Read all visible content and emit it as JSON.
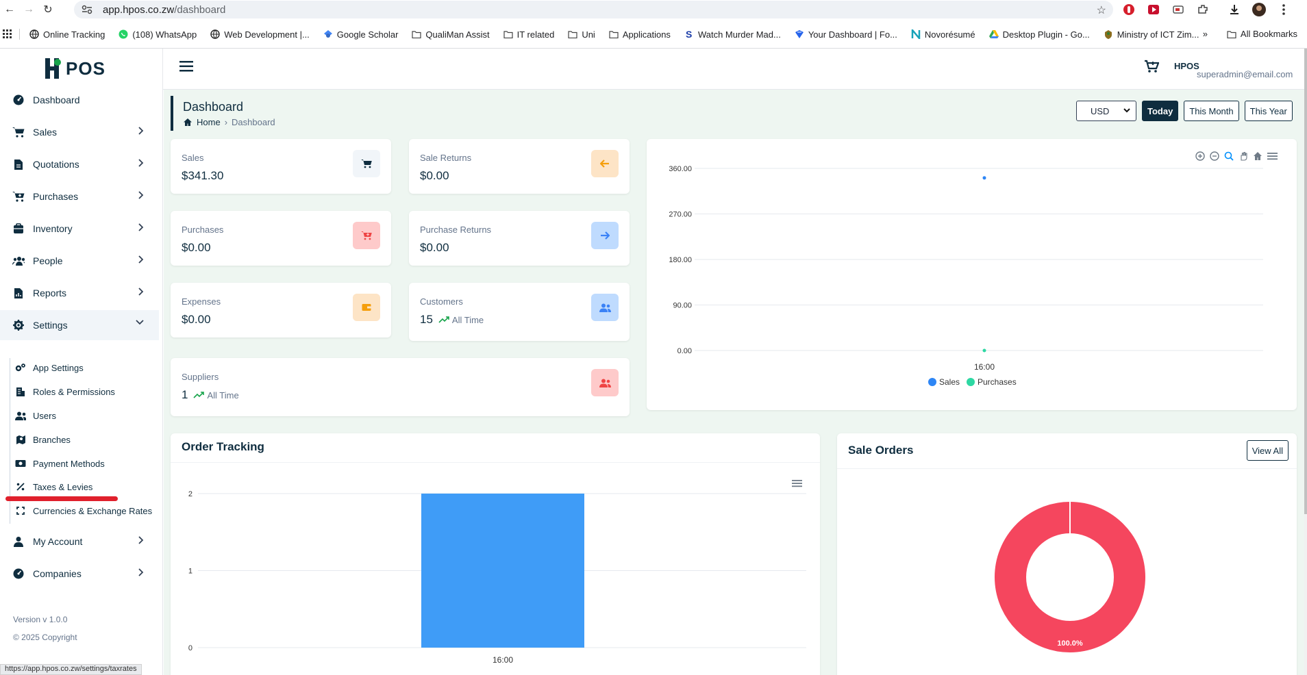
{
  "browser": {
    "url_host": "app.hpos.co.zw",
    "url_path": "/dashboard",
    "bookmarks": [
      {
        "label": "Online Tracking",
        "icon": "globe-icon"
      },
      {
        "label": "(108) WhatsApp",
        "icon": "whatsapp-icon"
      },
      {
        "label": "Web Development |...",
        "icon": "globe-icon"
      },
      {
        "label": "Google Scholar",
        "icon": "scholar-icon"
      },
      {
        "label": "QualiMan Assist",
        "icon": "folder-icon"
      },
      {
        "label": "IT related",
        "icon": "folder-icon"
      },
      {
        "label": "Uni",
        "icon": "folder-icon"
      },
      {
        "label": "Applications",
        "icon": "folder-icon"
      },
      {
        "label": "Watch Murder Mad...",
        "icon": "s-icon"
      },
      {
        "label": "Your Dashboard | Fo...",
        "icon": "dashboard-icon"
      },
      {
        "label": "Novorésumé",
        "icon": "n-icon"
      },
      {
        "label": "Desktop Plugin - Go...",
        "icon": "drive-icon"
      },
      {
        "label": "Ministry of ICT Zim...",
        "icon": "crest-icon"
      }
    ],
    "more_label": "»",
    "all_bookmarks": "All Bookmarks",
    "status_url": "https://app.hpos.co.zw/settings/taxrates"
  },
  "app": {
    "logo_text": "POS",
    "mini_logo": "HPOS",
    "user_email": "superadmin@email.com"
  },
  "sidebar": {
    "items": [
      {
        "label": "Dashboard",
        "icon": "dashboard-icon"
      },
      {
        "label": "Sales",
        "icon": "cart-icon"
      },
      {
        "label": "Quotations",
        "icon": "document-icon"
      },
      {
        "label": "Purchases",
        "icon": "cart-plus-icon"
      },
      {
        "label": "Inventory",
        "icon": "box-icon"
      },
      {
        "label": "People",
        "icon": "people-icon"
      },
      {
        "label": "Reports",
        "icon": "report-icon"
      },
      {
        "label": "Settings",
        "icon": "gear-icon"
      }
    ],
    "settings_sub": [
      {
        "label": "App Settings",
        "icon": "cogs-icon"
      },
      {
        "label": "Roles & Permissions",
        "icon": "building-icon"
      },
      {
        "label": "Users",
        "icon": "users-icon"
      },
      {
        "label": "Branches",
        "icon": "map-icon"
      },
      {
        "label": "Payment Methods",
        "icon": "money-icon"
      },
      {
        "label": "Taxes & Levies",
        "icon": "percent-icon"
      },
      {
        "label": "Currencies & Exchange Rates",
        "icon": "expand-icon"
      }
    ],
    "bottom_items": [
      {
        "label": "My Account",
        "icon": "user-icon"
      },
      {
        "label": "Companies",
        "icon": "dashboard-icon"
      }
    ],
    "version": "Version v 1.0.0",
    "copyright": "© 2025 Copyright"
  },
  "header": {
    "title": "Dashboard",
    "breadcrumb_home": "Home",
    "breadcrumb_current": "Dashboard",
    "currency": "USD",
    "periods": [
      "Today",
      "This Month",
      "This Year"
    ]
  },
  "stats": [
    {
      "label": "Sales",
      "value": "$341.30",
      "color": "#f1f5f9",
      "icon_color": "#0f2d3f",
      "icon": "cart-icon"
    },
    {
      "label": "Sale Returns",
      "value": "$0.00",
      "color": "#fde4c6",
      "icon_color": "#f59e0b",
      "icon": "arrow-left-icon"
    },
    {
      "label": "Purchases",
      "value": "$0.00",
      "color": "#fecaca",
      "icon_color": "#ef4444",
      "icon": "cart-plus-icon"
    },
    {
      "label": "Purchase Returns",
      "value": "$0.00",
      "color": "#bfdbfe",
      "icon_color": "#3b82f6",
      "icon": "arrow-right-icon"
    },
    {
      "label": "Expenses",
      "value": "$0.00",
      "color": "#fde4c6",
      "icon_color": "#f59e0b",
      "icon": "wallet-icon"
    },
    {
      "label": "Customers",
      "value": "15",
      "trend": "All Time",
      "color": "#bfdbfe",
      "icon_color": "#3b82f6",
      "icon": "users-icon"
    },
    {
      "label": "Suppliers",
      "value": "1",
      "trend": "All Time",
      "color": "#fecaca",
      "icon_color": "#ef4444",
      "icon": "users-icon"
    }
  ],
  "order_tracking_title": "Order Tracking",
  "sale_orders_title": "Sale Orders",
  "view_all": "View All",
  "chart_data": [
    {
      "type": "scatter",
      "x": [
        "16:00"
      ],
      "series": [
        {
          "name": "Sales",
          "values": [
            341.3
          ],
          "color": "#2e86f5"
        },
        {
          "name": "Purchases",
          "values": [
            0
          ],
          "color": "#2ed8a3"
        }
      ],
      "yticks": [
        "360.00",
        "270.00",
        "180.00",
        "90.00",
        "0.00"
      ],
      "ylim": [
        0,
        360
      ],
      "legend": "bottom"
    },
    {
      "type": "bar",
      "categories": [
        "16:00"
      ],
      "values": [
        2
      ],
      "yticks": [
        "2",
        "1",
        "0"
      ],
      "ylim": [
        0,
        2
      ],
      "color": "#3f9cf7"
    },
    {
      "type": "pie",
      "labels": [
        "100.0%"
      ],
      "values": [
        100
      ],
      "color": "#f5465e"
    }
  ]
}
